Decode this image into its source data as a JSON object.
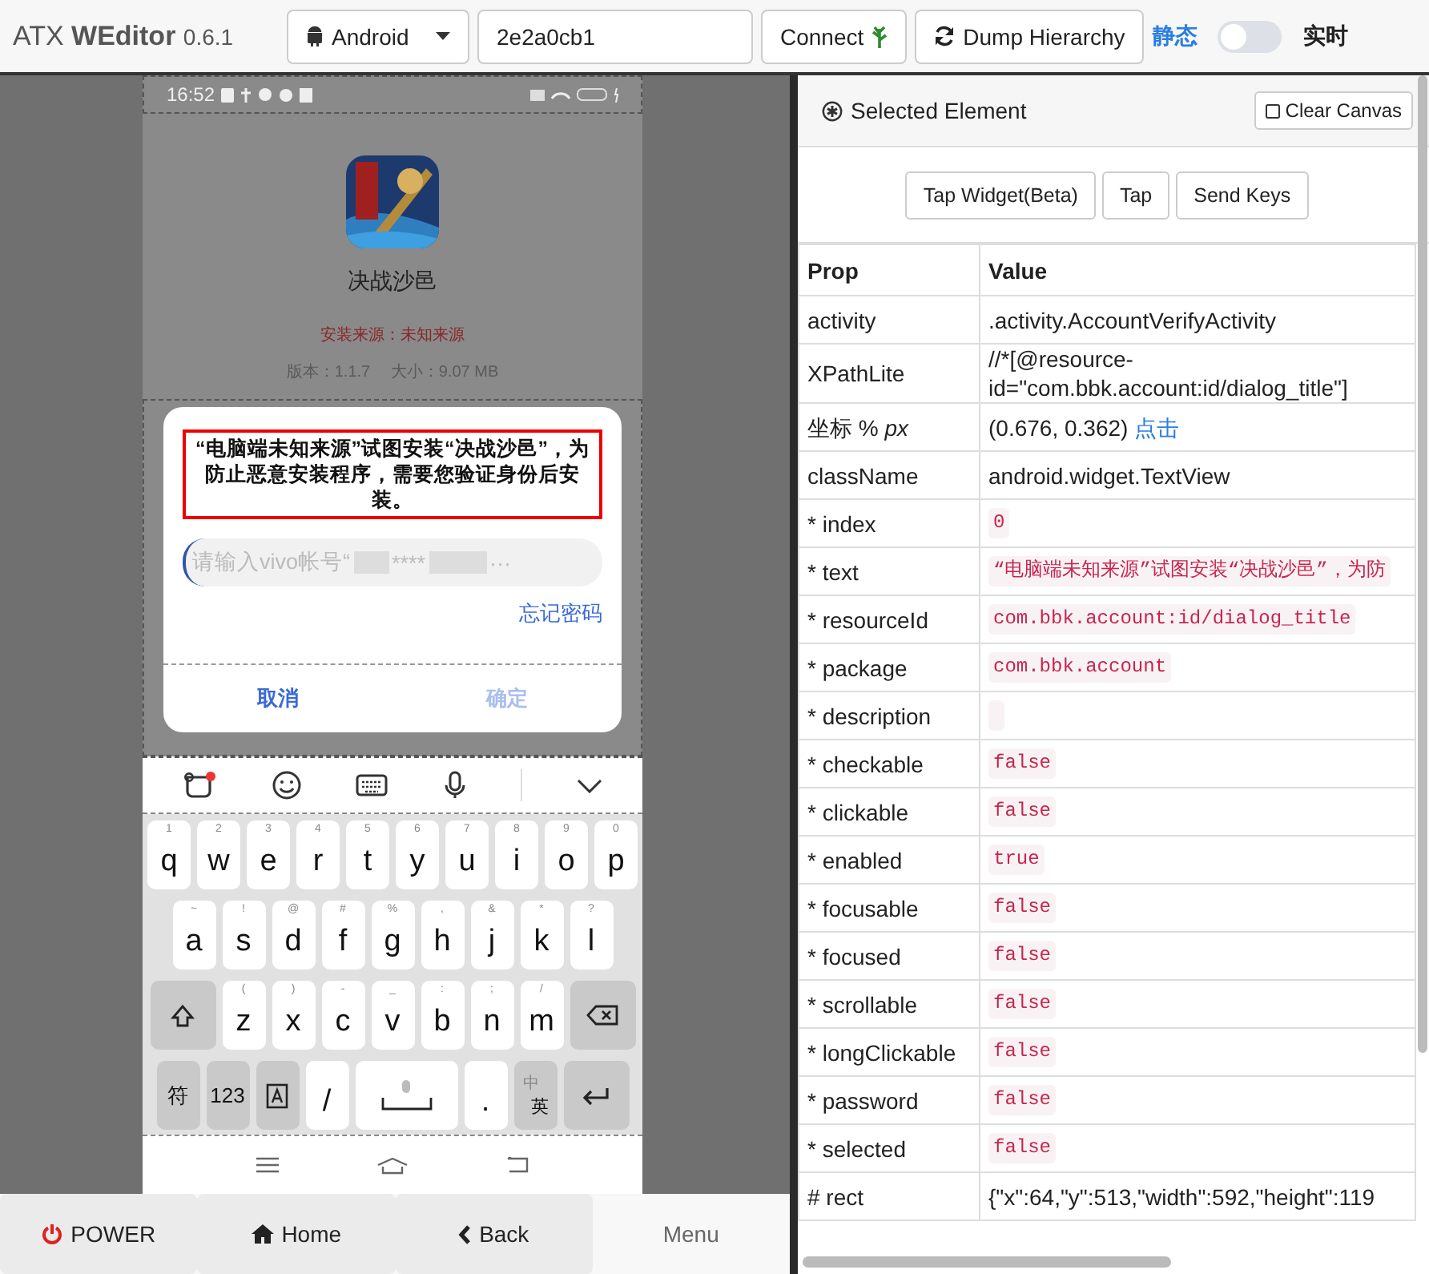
{
  "topbar": {
    "brand": "ATX **WEditor**",
    "version": "0.6.1",
    "platform": "Android",
    "serial": "2e2a0cb1",
    "connect": "Connect",
    "dump": "Dump Hierarchy",
    "mode": {
      "left_label": "静态",
      "right_label": "实时",
      "on": false
    }
  },
  "phone": {
    "status_time": "16:52",
    "app_name": "决战沙邑",
    "source": "安装来源：未知来源",
    "version_info": "版本：1.1.7　 大小：9.07 MB",
    "dialog": {
      "title": "“电脑端未知来源”试图安装“决战沙邑”，为防止恶意安装程序，需要您验证身份后安装。",
      "title_selected": true,
      "placeholder": "请输入vivo帐号“",
      "masked": "****",
      "tail": "···",
      "forgot": "忘记密码",
      "cancel": "取消",
      "confirm": "确定",
      "confirm_disabled": true
    },
    "keyboard": [
      [
        {
          "kind": "letter",
          "label": "q",
          "hint": "1"
        },
        {
          "kind": "letter",
          "label": "w",
          "hint": "2"
        },
        {
          "kind": "letter",
          "label": "e",
          "hint": "3"
        },
        {
          "kind": "letter",
          "label": "r",
          "hint": "4"
        },
        {
          "kind": "letter",
          "label": "t",
          "hint": "5"
        },
        {
          "kind": "letter",
          "label": "y",
          "hint": "6"
        },
        {
          "kind": "letter",
          "label": "u",
          "hint": "7"
        },
        {
          "kind": "letter",
          "label": "i",
          "hint": "8"
        },
        {
          "kind": "letter",
          "label": "o",
          "hint": "9"
        },
        {
          "kind": "letter",
          "label": "p",
          "hint": "0"
        }
      ],
      [
        {
          "kind": "letter",
          "label": "a",
          "hint": "~"
        },
        {
          "kind": "letter",
          "label": "s",
          "hint": "!"
        },
        {
          "kind": "letter",
          "label": "d",
          "hint": "@"
        },
        {
          "kind": "letter",
          "label": "f",
          "hint": "#"
        },
        {
          "kind": "letter",
          "label": "g",
          "hint": "%"
        },
        {
          "kind": "letter",
          "label": "h",
          "hint": ","
        },
        {
          "kind": "letter",
          "label": "j",
          "hint": "&"
        },
        {
          "kind": "letter",
          "label": "k",
          "hint": "*"
        },
        {
          "kind": "letter",
          "label": "l",
          "hint": "?"
        }
      ],
      [
        {
          "kind": "shift"
        },
        {
          "kind": "letter",
          "label": "z",
          "hint": "("
        },
        {
          "kind": "letter",
          "label": "x",
          "hint": ")"
        },
        {
          "kind": "letter",
          "label": "c",
          "hint": "-"
        },
        {
          "kind": "letter",
          "label": "v",
          "hint": "_"
        },
        {
          "kind": "letter",
          "label": "b",
          "hint": ":"
        },
        {
          "kind": "letter",
          "label": "n",
          "hint": ";"
        },
        {
          "kind": "letter",
          "label": "m",
          "hint": "/"
        },
        {
          "kind": "backspace"
        }
      ],
      [
        {
          "kind": "symbol",
          "label": "符"
        },
        {
          "kind": "symbol",
          "label": "123"
        },
        {
          "kind": "caps"
        },
        {
          "kind": "white",
          "label": "/"
        },
        {
          "kind": "space"
        },
        {
          "kind": "white",
          "label": "."
        },
        {
          "kind": "lang",
          "label": "中",
          "sub": "英"
        },
        {
          "kind": "enter"
        }
      ]
    ]
  },
  "device_buttons": [
    {
      "kind": "power",
      "label": "POWER",
      "shaded": true
    },
    {
      "kind": "home",
      "label": "Home",
      "shaded": true
    },
    {
      "kind": "back",
      "label": "Back",
      "shaded": true
    },
    {
      "kind": "plain",
      "label": "Menu",
      "shaded": false
    }
  ],
  "inspector": {
    "title": "Selected Element",
    "clear": "Clear Canvas",
    "actions": [
      "Tap Widget(Beta)",
      "Tap",
      "Send Keys"
    ],
    "columns": [
      "Prop",
      "Value"
    ],
    "rows": [
      {
        "prop": "activity",
        "kind": "plain",
        "value": ".activity.AccountVerifyActivity"
      },
      {
        "prop": "XPathLite",
        "kind": "plain",
        "value": "//*[@resource-",
        "value2": "id=\"com.bbk.account:id/dialog_title\"]"
      },
      {
        "prop": "坐标 % *px*",
        "kind": "link",
        "value": "(0.676, 0.362)",
        "link": "点击"
      },
      {
        "prop": "className",
        "kind": "plain",
        "value": "android.widget.TextView"
      },
      {
        "prop": "* index",
        "kind": "code",
        "value": "0"
      },
      {
        "prop": "* text",
        "kind": "code",
        "value": "“电脑端未知来源”试图安装“决战沙邑”，为防"
      },
      {
        "prop": "* resourceId",
        "kind": "code",
        "value": "com.bbk.account:id/dialog_title"
      },
      {
        "prop": "* package",
        "kind": "code",
        "value": "com.bbk.account"
      },
      {
        "prop": "* description",
        "kind": "code"
      },
      {
        "prop": "* checkable",
        "kind": "code",
        "value": "false"
      },
      {
        "prop": "* clickable",
        "kind": "code",
        "value": "false"
      },
      {
        "prop": "* enabled",
        "kind": "code",
        "value": "true"
      },
      {
        "prop": "* focusable",
        "kind": "code",
        "value": "false"
      },
      {
        "prop": "* focused",
        "kind": "code",
        "value": "false"
      },
      {
        "prop": "* scrollable",
        "kind": "code",
        "value": "false"
      },
      {
        "prop": "* longClickable",
        "kind": "code",
        "value": "false"
      },
      {
        "prop": "* password",
        "kind": "code",
        "value": "false"
      },
      {
        "prop": "* selected",
        "kind": "code",
        "value": "false"
      },
      {
        "prop": "# rect",
        "kind": "plain",
        "value": "{\"x\":64,\"y\":513,\"width\":592,\"height\":119"
      }
    ]
  }
}
